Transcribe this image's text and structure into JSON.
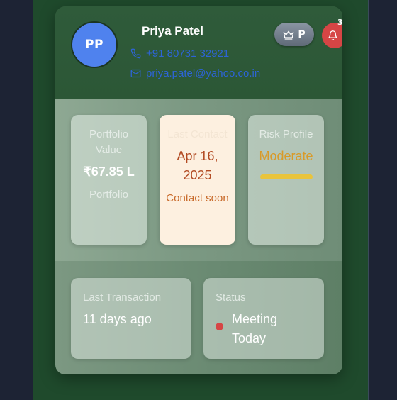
{
  "client": {
    "initials": "PP",
    "name": "Priya Patel",
    "phone": "+91 80731 32921",
    "email": "priya.patel@yahoo.co.in",
    "plan_badge": "P",
    "notification_count": "3"
  },
  "metrics": [
    {
      "label": "Portfolio Value",
      "value": "₹67.85 L",
      "sub": "Portfolio"
    },
    {
      "label": "Last Contact",
      "value": "Apr 16, 2025",
      "sub": "Contact soon"
    },
    {
      "label": "Risk Profile",
      "value": "Moderate"
    }
  ],
  "info": {
    "last_transaction": {
      "label": "Last Transaction",
      "value": "11 days ago"
    },
    "status": {
      "label": "Status",
      "value": "Meeting Today"
    }
  },
  "colors": {
    "avatar": "#4f82ee",
    "link": "#2d64d6",
    "notification": "#d64545",
    "risk_moderate": "#e9c43c",
    "contact_value": "#b24a22"
  },
  "icons": {
    "phone": "phone-icon",
    "email": "mail-icon",
    "plan": "crown-icon",
    "notification": "bell-icon"
  }
}
